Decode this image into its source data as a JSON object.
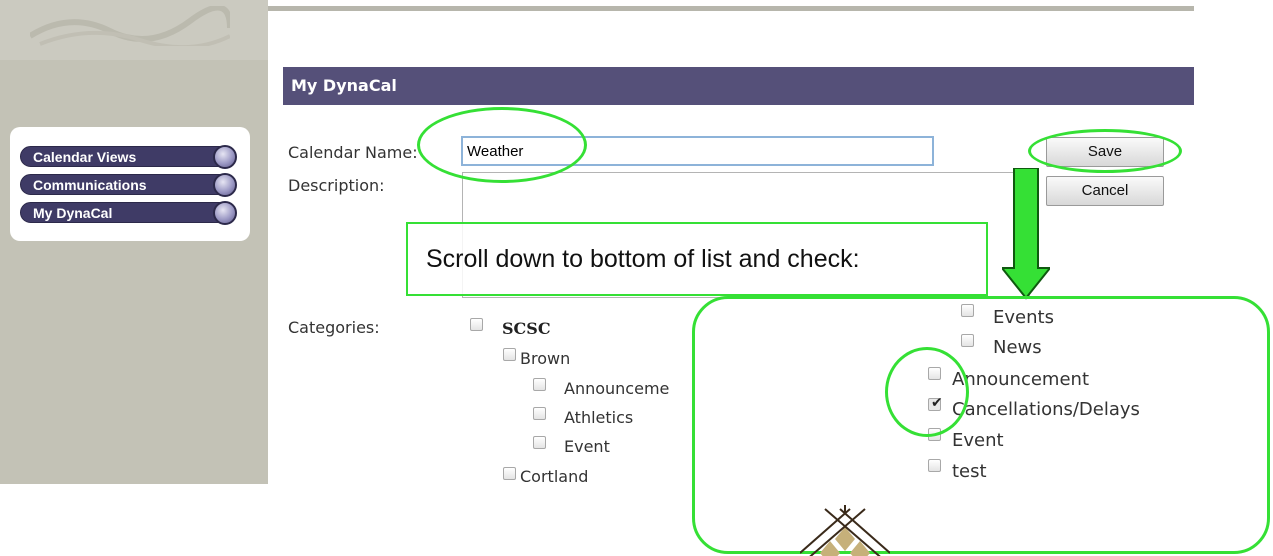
{
  "nav": {
    "items": [
      {
        "label": "Calendar Views"
      },
      {
        "label": "Communications"
      },
      {
        "label": "My DynaCal"
      }
    ]
  },
  "panel": {
    "header": "My DynaCal"
  },
  "form": {
    "calendar_name_label": "Calendar Name:",
    "calendar_name_value": "Weather",
    "description_label": "Description:",
    "categories_label": "Categories:",
    "save_label": "Save",
    "cancel_label": "Cancel"
  },
  "annotation": {
    "instruction": "Scroll down to bottom of list and check:"
  },
  "categories": {
    "left": [
      {
        "label": "SCSC",
        "checked": false
      },
      {
        "label": "Brown",
        "checked": false
      },
      {
        "label": "Announceme",
        "checked": false
      },
      {
        "label": "Athletics",
        "checked": false
      },
      {
        "label": "Event",
        "checked": false
      },
      {
        "label": "Cortland",
        "checked": false
      }
    ],
    "right": [
      {
        "label": "Events",
        "checked": false
      },
      {
        "label": "News",
        "checked": false
      },
      {
        "label": "Announcement",
        "checked": false
      },
      {
        "label": "Cancellations/Delays",
        "checked": true
      },
      {
        "label": "Event",
        "checked": false
      },
      {
        "label": "test",
        "checked": false
      }
    ]
  },
  "colors": {
    "highlight": "#35e035",
    "header_bg": "#555079",
    "nav_bg": "#3f3b66"
  }
}
